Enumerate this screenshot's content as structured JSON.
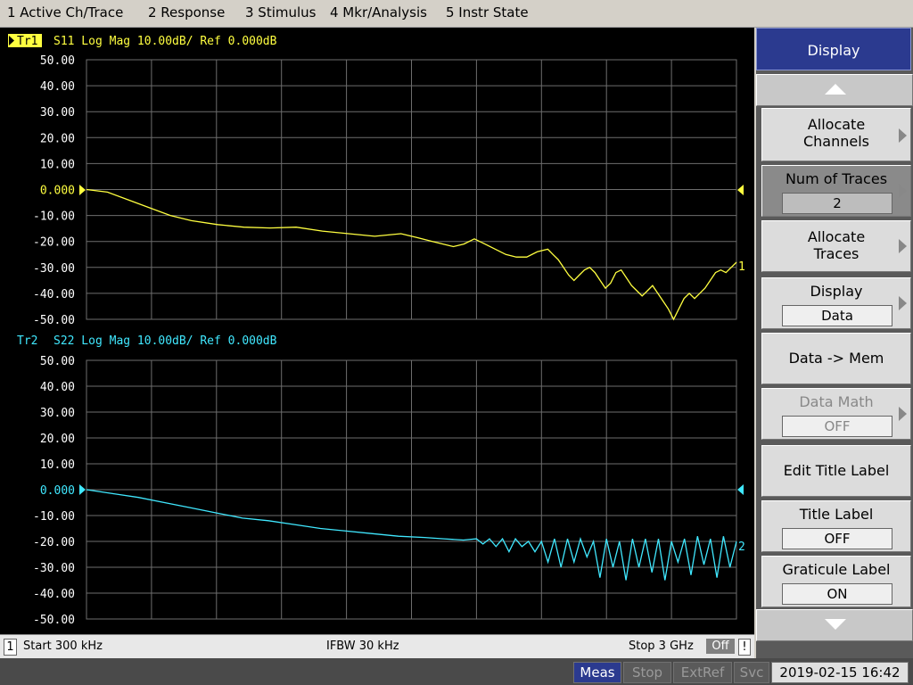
{
  "menu": [
    "1 Active Ch/Trace",
    "2 Response",
    "3 Stimulus",
    "4 Mkr/Analysis",
    "5 Instr State"
  ],
  "trace1": {
    "tag": "Tr1",
    "header": "S11 Log Mag 10.00dB/ Ref 0.000dB",
    "color": "#ffff40",
    "marker_label": "1"
  },
  "trace2": {
    "tag": "Tr2",
    "header": "S22 Log Mag 10.00dB/ Ref 0.000dB",
    "color": "#40e8ff",
    "marker_label": "2"
  },
  "chart_data": [
    {
      "type": "line",
      "title": "Tr1 S11 Log Mag 10.00dB/ Ref 0.000dB",
      "y_ticks": [
        "50.00",
        "40.00",
        "30.00",
        "20.00",
        "10.00",
        "0.000",
        "-10.00",
        "-20.00",
        "-30.00",
        "-40.00",
        "-50.00"
      ],
      "ylim": [
        -50,
        50
      ],
      "xlim": [
        0,
        100
      ],
      "grid": true,
      "series": [
        {
          "values": [
            [
              0,
              0
            ],
            [
              4,
              -1
            ],
            [
              8,
              -4
            ],
            [
              12,
              -7
            ],
            [
              16,
              -10
            ],
            [
              20,
              -12
            ],
            [
              25,
              -13.5
            ],
            [
              30,
              -14.5
            ],
            [
              35,
              -14.8
            ],
            [
              40,
              -14.5
            ],
            [
              45,
              -16
            ],
            [
              50,
              -17
            ],
            [
              55,
              -18
            ],
            [
              60,
              -17
            ],
            [
              63,
              -18.5
            ],
            [
              66,
              -20
            ],
            [
              70,
              -22
            ],
            [
              72,
              -21
            ],
            [
              74,
              -19
            ],
            [
              76,
              -21
            ],
            [
              78,
              -23
            ],
            [
              80,
              -25
            ],
            [
              82,
              -26
            ],
            [
              84,
              -26
            ],
            [
              86,
              -24
            ],
            [
              88,
              -23
            ],
            [
              89,
              -25
            ],
            [
              90,
              -27
            ],
            [
              91,
              -30
            ],
            [
              92,
              -33
            ],
            [
              93,
              -35
            ],
            [
              94,
              -33
            ],
            [
              95,
              -31
            ],
            [
              96,
              -30
            ],
            [
              97,
              -32
            ],
            [
              98,
              -35
            ],
            [
              99,
              -38
            ],
            [
              100,
              -36
            ],
            [
              101,
              -32
            ],
            [
              102,
              -31
            ],
            [
              103,
              -34
            ],
            [
              104,
              -37
            ],
            [
              105,
              -39
            ],
            [
              106,
              -41
            ],
            [
              107,
              -39
            ],
            [
              108,
              -37
            ],
            [
              109,
              -40
            ],
            [
              110,
              -43
            ],
            [
              111,
              -46
            ],
            [
              112,
              -50
            ],
            [
              113,
              -46
            ],
            [
              114,
              -42
            ],
            [
              115,
              -40
            ],
            [
              116,
              -42
            ],
            [
              117,
              -40
            ],
            [
              118,
              -38
            ],
            [
              119,
              -35
            ],
            [
              120,
              -32
            ],
            [
              121,
              -31
            ],
            [
              122,
              -32
            ],
            [
              123,
              -30
            ],
            [
              124,
              -28
            ]
          ]
        }
      ]
    },
    {
      "type": "line",
      "title": "Tr2 S22 Log Mag 10.00dB/ Ref 0.000dB",
      "y_ticks": [
        "50.00",
        "40.00",
        "30.00",
        "20.00",
        "10.00",
        "0.000",
        "-10.00",
        "-20.00",
        "-30.00",
        "-40.00",
        "-50.00"
      ],
      "ylim": [
        -50,
        50
      ],
      "xlim": [
        0,
        100
      ],
      "grid": true,
      "series": [
        {
          "values": [
            [
              0,
              0
            ],
            [
              4,
              -1.5
            ],
            [
              8,
              -3
            ],
            [
              12,
              -5
            ],
            [
              16,
              -7
            ],
            [
              20,
              -9
            ],
            [
              24,
              -11
            ],
            [
              28,
              -12
            ],
            [
              32,
              -13.5
            ],
            [
              36,
              -15
            ],
            [
              40,
              -16
            ],
            [
              44,
              -17
            ],
            [
              48,
              -18
            ],
            [
              52,
              -18.5
            ],
            [
              55,
              -19
            ],
            [
              58,
              -19.5
            ],
            [
              60,
              -19
            ],
            [
              61,
              -21
            ],
            [
              62,
              -19
            ],
            [
              63,
              -22
            ],
            [
              64,
              -19
            ],
            [
              65,
              -24
            ],
            [
              66,
              -19
            ],
            [
              67,
              -22
            ],
            [
              68,
              -20
            ],
            [
              69,
              -24
            ],
            [
              70,
              -20
            ],
            [
              71,
              -28
            ],
            [
              72,
              -19
            ],
            [
              73,
              -30
            ],
            [
              74,
              -19
            ],
            [
              75,
              -28
            ],
            [
              76,
              -19
            ],
            [
              77,
              -26
            ],
            [
              78,
              -20
            ],
            [
              79,
              -34
            ],
            [
              80,
              -19
            ],
            [
              81,
              -30
            ],
            [
              82,
              -20
            ],
            [
              83,
              -35
            ],
            [
              84,
              -19
            ],
            [
              85,
              -30
            ],
            [
              86,
              -19
            ],
            [
              87,
              -32
            ],
            [
              88,
              -19
            ],
            [
              89,
              -35
            ],
            [
              90,
              -20
            ],
            [
              91,
              -28
            ],
            [
              92,
              -19
            ],
            [
              93,
              -33
            ],
            [
              94,
              -18
            ],
            [
              95,
              -29
            ],
            [
              96,
              -19
            ],
            [
              97,
              -34
            ],
            [
              98,
              -18
            ],
            [
              99,
              -30
            ],
            [
              100,
              -20
            ]
          ]
        }
      ]
    }
  ],
  "status1": {
    "channel": "1",
    "start": "Start 300 kHz",
    "ifbw": "IFBW 30 kHz",
    "stop": "Stop 3 GHz",
    "off": "Off",
    "bang": "!"
  },
  "status2": {
    "meas": "Meas",
    "stop": "Stop",
    "extref": "ExtRef",
    "svc": "Svc",
    "datetime": "2019-02-15 16:42"
  },
  "softkeys": {
    "title": "Display",
    "allocate_channels": [
      "Allocate",
      "Channels"
    ],
    "num_traces": {
      "label": "Num of Traces",
      "value": "2"
    },
    "allocate_traces": [
      "Allocate",
      "Traces"
    ],
    "display": {
      "label": "Display",
      "value": "Data"
    },
    "data_to_mem": "Data -> Mem",
    "data_math": {
      "label": "Data Math",
      "value": "OFF"
    },
    "edit_title_label": "Edit Title Label",
    "title_label": {
      "label": "Title Label",
      "value": "OFF"
    },
    "graticule_label": {
      "label": "Graticule Label",
      "value": "ON"
    }
  },
  "colors": {
    "grid": "#6e6e6e",
    "axis_text": "#ffffff",
    "trace1": "#ffff40",
    "trace2": "#40e8ff",
    "softkey_title_bg": "#2b3a8f",
    "meas_chip": "#2b3a8f"
  }
}
